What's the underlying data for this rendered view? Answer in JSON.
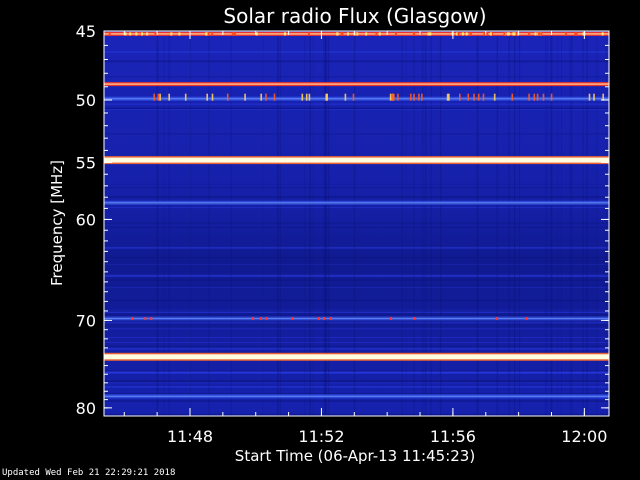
{
  "chart_data": {
    "type": "heatmap",
    "title": "Solar radio Flux (Glasgow)",
    "ylabel": "Frequency [MHz]",
    "xlabel": "Start Time (06-Apr-13 11:45:23)",
    "y_scale": "log",
    "y_range_mhz": [
      45,
      81
    ],
    "y_ticks": [
      {
        "value": 45,
        "label": "45"
      },
      {
        "value": 50,
        "label": "50"
      },
      {
        "value": 55,
        "label": "55"
      },
      {
        "value": 60,
        "label": "60"
      },
      {
        "value": 70,
        "label": "70"
      },
      {
        "value": 80,
        "label": "80"
      }
    ],
    "x_range": [
      "11:45:23",
      "12:00:45"
    ],
    "x_ticks": [
      {
        "value": "11:48",
        "label": "11:48"
      },
      {
        "value": "11:52",
        "label": "11:52"
      },
      {
        "value": "11:56",
        "label": "11:56"
      },
      {
        "value": "12:00",
        "label": "12:00"
      }
    ],
    "colormap": {
      "low": "#0a0a80",
      "mid": "#1f2bd0",
      "high": "#ff3322",
      "peak": "#fffde0"
    },
    "bright_bands_mhz": [
      {
        "freq": 45.2,
        "intensity": 0.7
      },
      {
        "freq": 48.8,
        "intensity": 0.8
      },
      {
        "freq": 49.9,
        "intensity": 0.55
      },
      {
        "freq": 54.8,
        "intensity": 1.0
      },
      {
        "freq": 58.5,
        "intensity": 0.35
      },
      {
        "freq": 69.8,
        "intensity": 0.35
      },
      {
        "freq": 74.0,
        "intensity": 1.0
      },
      {
        "freq": 78.6,
        "intensity": 0.4
      }
    ],
    "footer": "Updated Wed Feb 21 22:29:21 2018"
  }
}
